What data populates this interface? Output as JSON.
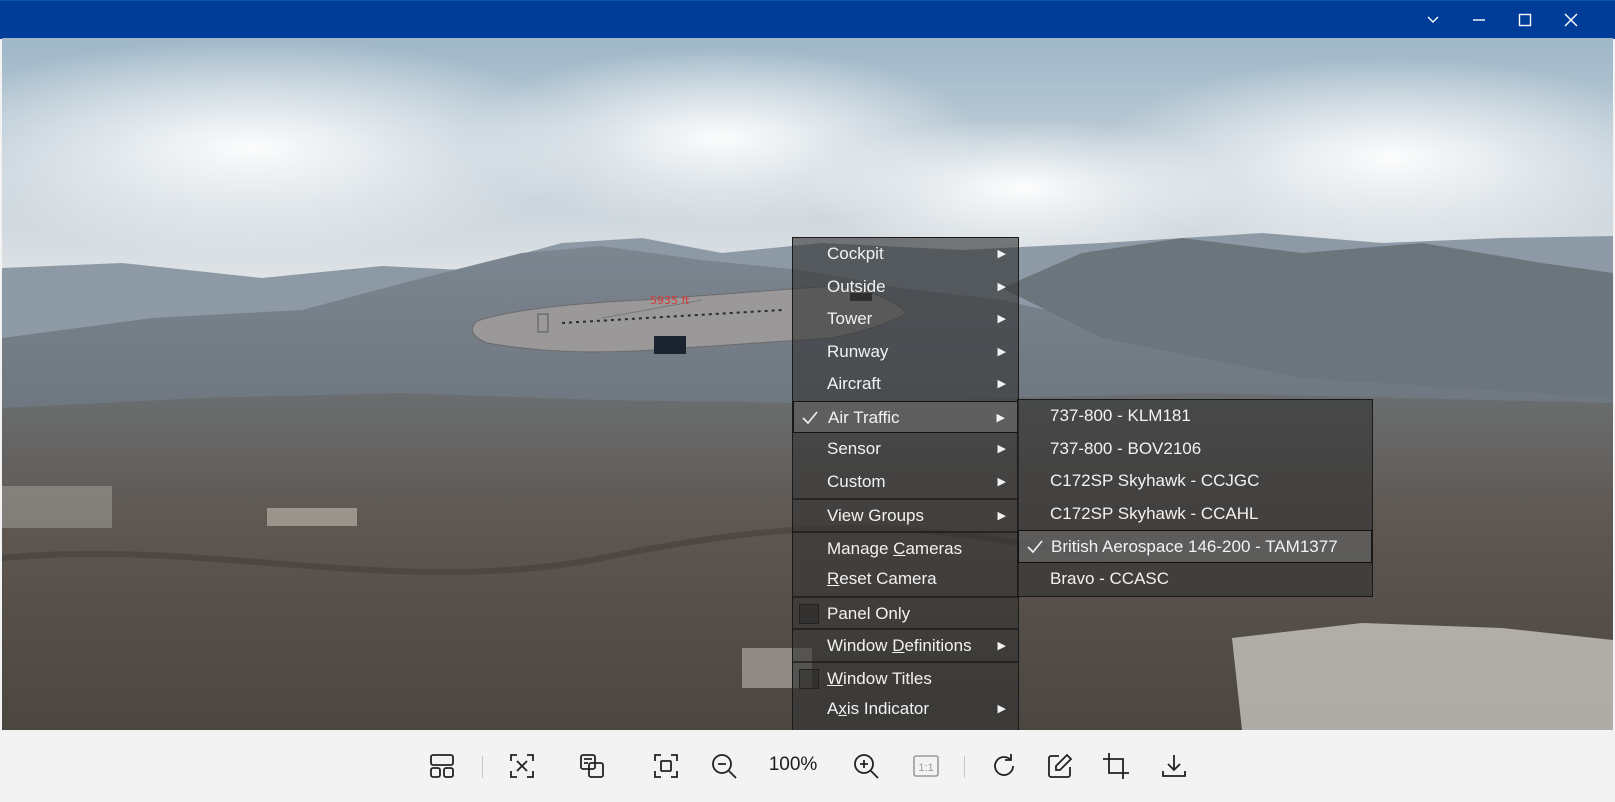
{
  "window": {
    "controls": [
      "chevron-down-icon",
      "minimize-icon",
      "maximize-icon",
      "close-icon"
    ],
    "titlebar_color": "#003d99"
  },
  "scene": {
    "altitude_label": "5935 ft"
  },
  "context_menu": {
    "items": [
      {
        "label": "Cockpit",
        "submenu": true
      },
      {
        "label": "Outside",
        "submenu": true
      },
      {
        "label": "Tower",
        "submenu": true
      },
      {
        "label": "Runway",
        "submenu": true
      },
      {
        "label": "Aircraft",
        "submenu": true
      },
      {
        "label": "Air Traffic",
        "submenu": true,
        "checked": true
      },
      {
        "label": "Sensor",
        "submenu": true
      },
      {
        "label": "Custom",
        "submenu": true
      },
      {
        "label": "View Groups",
        "submenu": true
      },
      {
        "label_pre": "Manage ",
        "label_u": "C",
        "label_post": "ameras"
      },
      {
        "label_pre": "",
        "label_u": "R",
        "label_post": "eset Camera"
      },
      {
        "label": "Panel Only",
        "checkbox": true,
        "checked": false
      },
      {
        "label_pre": "Window ",
        "label_u": "D",
        "label_post": "efinitions",
        "submenu": true
      },
      {
        "label_pre": "",
        "label_u": "W",
        "label_post": "indow Titles",
        "checkbox": true,
        "checked": false
      },
      {
        "label_pre": "A",
        "label_u": "x",
        "label_post": "is Indicator",
        "submenu": true
      }
    ]
  },
  "air_traffic_submenu": {
    "items": [
      {
        "label": "737-800 - KLM181"
      },
      {
        "label": "737-800 - BOV2106"
      },
      {
        "label": "C172SP Skyhawk - CCJGC"
      },
      {
        "label": "C172SP Skyhawk - CCAHL"
      },
      {
        "label": "British Aerospace 146-200 - TAM1377",
        "checked": true
      },
      {
        "label": "Bravo - CCASC"
      }
    ]
  },
  "toolbar": {
    "zoom_level": "100%",
    "icons": [
      "layout-icon",
      "fit-screen-icon",
      "compare-icon",
      "fullscreen-icon",
      "zoom-out-icon",
      "zoom-in-icon",
      "actual-size-icon",
      "rotate-icon",
      "edit-icon",
      "crop-icon",
      "download-icon"
    ]
  }
}
